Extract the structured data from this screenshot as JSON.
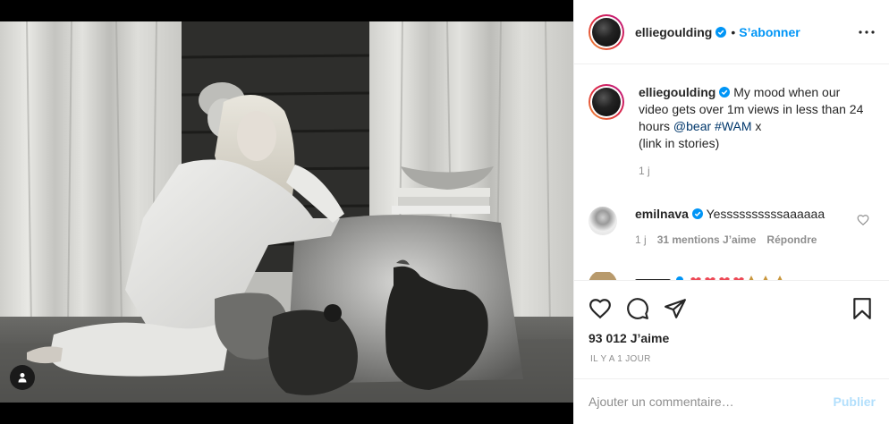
{
  "post": {
    "username": "elliegoulding",
    "follow_label": "S’abonner",
    "separator": "•",
    "more_icon": "more-horizontal-icon"
  },
  "caption": {
    "username": "elliegoulding",
    "text_before": "My mood when our video gets over 1m views in less than 24 hours ",
    "mention": "@bear",
    "hashtag": "#WAM",
    "text_after": " x",
    "line2": "(link in stories)",
    "time": "1 j"
  },
  "comments": [
    {
      "username": "emilnava",
      "text": "Yessssssssssaaaaaa",
      "time": "1 j",
      "likes": "31 mentions J’aime",
      "reply_label": "Répondre"
    }
  ],
  "actions": {
    "likes": "93 012 J’aime",
    "posted": "IL Y A 1 JOUR"
  },
  "composer": {
    "placeholder": "Ajouter un commentaire…",
    "publish_label": "Publier"
  },
  "colors": {
    "accent": "#0095f6",
    "link": "#00376b",
    "muted": "#8e8e8e",
    "heart": "#ed4956"
  }
}
